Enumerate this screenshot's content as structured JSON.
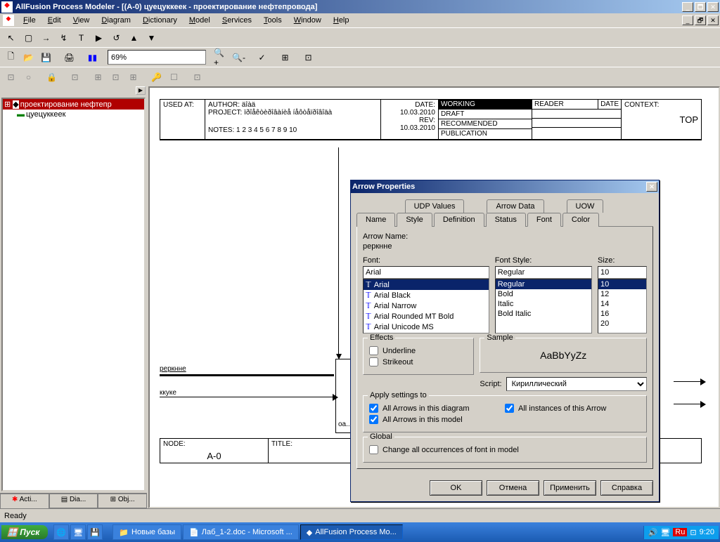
{
  "title": "AllFusion Process Modeler - [(A-0) цуецуккеек - проектирование нефтепровода]",
  "menu": [
    "File",
    "Edit",
    "View",
    "Diagram",
    "Dictionary",
    "Model",
    "Services",
    "Tools",
    "Window",
    "Help"
  ],
  "zoom": "69%",
  "tree": {
    "root": "проектирование нефтепр",
    "child": "цуецуккеек"
  },
  "sidetabs": [
    "Acti...",
    "Dia...",
    "Obj..."
  ],
  "header": {
    "used_at_label": "USED AT:",
    "author_label": "AUTHOR:",
    "author": "äîàä",
    "date_label": "DATE:",
    "date": "10.03.2010",
    "project_label": "PROJECT:",
    "project": "ïðîåêòèðîâàíèå íåôòåïðîâîäà",
    "rev_label": "REV:",
    "rev": "10.03.2010",
    "notes_label": "NOTES:",
    "notes": "1  2  3  4  5  6  7  8  9  10",
    "st1": "WORKING",
    "st2": "DRAFT",
    "st3": "RECOMMENDED",
    "st4": "PUBLICATION",
    "reader": "READER",
    "hdate": "DATE",
    "context": "CONTEXT:",
    "top": "TOP"
  },
  "footer": {
    "node_label": "NODE:",
    "node": "A-0",
    "title_label": "TITLE:"
  },
  "arrows": {
    "a1": "реркнне",
    "a2": "ккуке"
  },
  "dialog": {
    "title": "Arrow Properties",
    "tabs1": [
      "UDP Values",
      "Arrow Data",
      "UOW"
    ],
    "tabs2": [
      "Name",
      "Style",
      "Definition",
      "Status",
      "Font",
      "Color"
    ],
    "arrow_name_label": "Arrow Name:",
    "arrow_name": "реркнне",
    "font_label": "Font:",
    "font_value": "Arial",
    "font_list": [
      "Arial",
      "Arial Black",
      "Arial Narrow",
      "Arial Rounded MT Bold",
      "Arial Unicode MS"
    ],
    "style_label": "Font Style:",
    "style_value": "Regular",
    "style_list": [
      "Regular",
      "Bold",
      "Italic",
      "Bold Italic"
    ],
    "size_label": "Size:",
    "size_value": "10",
    "size_list": [
      "10",
      "12",
      "14",
      "16",
      "20"
    ],
    "sample_label": "Sample",
    "sample": "AaBbYyZz",
    "effects_label": "Effects",
    "underline": "Underline",
    "strikeout": "Strikeout",
    "script_label": "Script:",
    "script": "Кириллический",
    "apply_label": "Apply settings to",
    "all_diagram": "All Arrows in this diagram",
    "all_model": "All Arrows in this model",
    "all_instances": "All instances of this Arrow",
    "global_label": "Global",
    "change_all": "Change all occurrences of font in model",
    "ok": "OK",
    "cancel": "Отмена",
    "apply": "Применить",
    "help": "Справка"
  },
  "status": "Ready",
  "taskbar": {
    "start": "Пуск",
    "items": [
      "Новые базы",
      "Лаб_1-2.doc - Microsoft ...",
      "AllFusion Process Mo..."
    ],
    "lang": "Ru",
    "time": "9:20"
  }
}
